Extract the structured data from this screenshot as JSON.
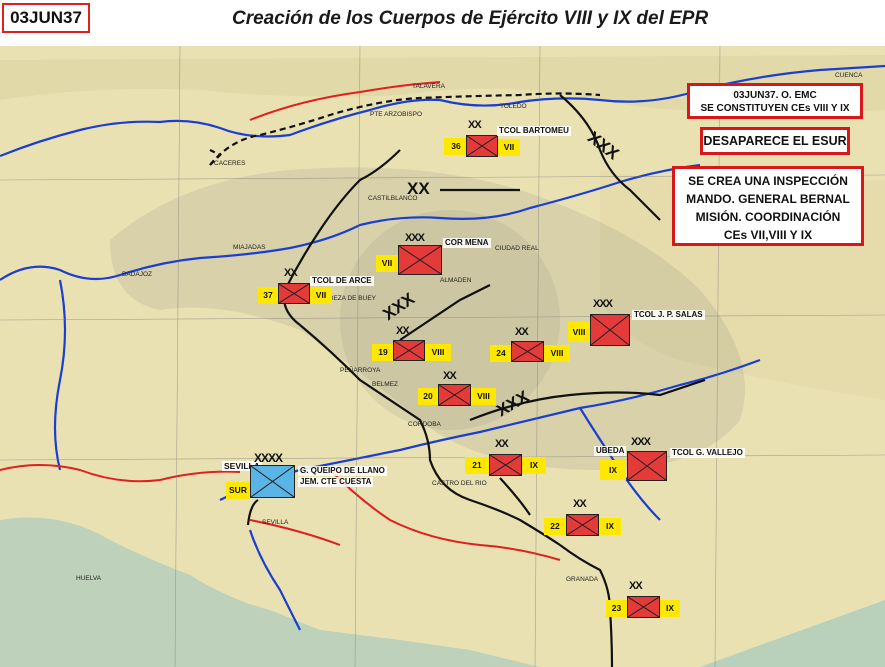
{
  "header": {
    "date": "03JUN37",
    "title": "Creación de los  Cuerpos de Ejército VIII y IX del EPR"
  },
  "notes": {
    "emc": [
      "03JUN37. O. EMC",
      "SE CONSTITUYEN CEs VIII Y IX"
    ],
    "esur": "DESAPARECE EL ESUR",
    "inspeccion": [
      "SE CREA UNA INSPECCIÓN",
      "MANDO. GENERAL BERNAL",
      "MISIÓN. COORDINACIÓN",
      "CEs VII,VIII Y IX"
    ]
  },
  "units": [
    {
      "id": "36",
      "corps": "VII",
      "echelon": "XX",
      "commander": "TCOL BARTOMEU"
    },
    {
      "id": "cor-mena",
      "corps": "VII",
      "echelon": "XXX",
      "commander": "COR MENA"
    },
    {
      "id": "37",
      "corps": "VII",
      "echelon": "XX",
      "commander": "TCOL DE ARCE"
    },
    {
      "id": "19",
      "corps": "VIII",
      "echelon": "XX"
    },
    {
      "id": "24",
      "corps": "VIII",
      "echelon": "XX"
    },
    {
      "id": "j-p-salas",
      "corps": "VIII",
      "echelon": "XXX",
      "commander": "TCOL J. P. SALAS"
    },
    {
      "id": "20",
      "corps": "VIII",
      "echelon": "XX"
    },
    {
      "id": "21",
      "corps": "IX",
      "echelon": "XX"
    },
    {
      "id": "g-vallejo",
      "corps": "IX",
      "echelon": "XXX",
      "commander": "TCOL G. VALLEJO",
      "place": "UBEDA"
    },
    {
      "id": "22",
      "corps": "IX",
      "echelon": "XX"
    },
    {
      "id": "23",
      "corps": "IX",
      "echelon": "XX"
    },
    {
      "id": "sur",
      "corps": "SUR",
      "echelon": "XXXX",
      "place": "SEVILLA",
      "commander": [
        "G. QUEIPO DE LLANO",
        "JEM. CTE CUESTA"
      ]
    }
  ],
  "boundaries": [
    "XX",
    "XXX",
    "XXX",
    "XXX"
  ],
  "towns": [
    "CACERES",
    "TALAVERA",
    "PTE ARZOBISPO",
    "MIAJADAS",
    "BADAJOZ",
    "CORDOBA",
    "GRANADA",
    "CUENCA",
    "CASTILBLANCO",
    "ALMADEN",
    "PEÑARROYA",
    "BELMEZ",
    "SEVILLA",
    "CASTRO DEL RIO",
    "HUELVA",
    "TOLEDO",
    "CIUDAD REAL",
    "CABEZA DE BUEY"
  ],
  "colors": {
    "hostile_unit": "#e53a3a",
    "friendly_army": "#5ab4e6",
    "highlight": "#ffe800",
    "note_border": "#d81818",
    "front_line": "#111111",
    "river": "#1a3fd0",
    "road": "#e02020"
  }
}
